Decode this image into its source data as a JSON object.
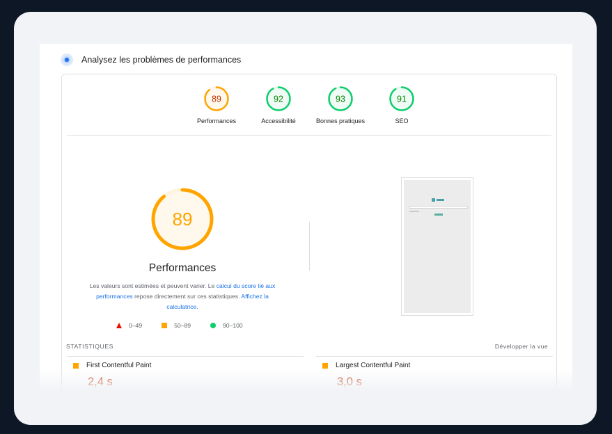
{
  "header": {
    "title": "Analysez les problèmes de performances",
    "icon": "lighthouse-icon"
  },
  "colors": {
    "average": "#ffa400",
    "good": "#0cce6b",
    "poor": "#eb0f00",
    "link": "#1a73e8",
    "value_average": "#c33300"
  },
  "gauges": [
    {
      "label": "Performances",
      "score": "89",
      "value": 89,
      "status": "average"
    },
    {
      "label": "Accessibilité",
      "score": "92",
      "value": 92,
      "status": "good"
    },
    {
      "label": "Bonnes pratiques",
      "score": "93",
      "value": 93,
      "status": "good"
    },
    {
      "label": "SEO",
      "score": "91",
      "value": 91,
      "status": "good"
    }
  ],
  "performance": {
    "score": "89",
    "value": 89,
    "title": "Performances",
    "desc_part1": "Les valeurs sont estimées et peuvent varier. Le ",
    "desc_link1": "calcul du score lié aux performances",
    "desc_part2": " repose directement sur ces statistiques. ",
    "desc_link2": "Affichez la calculatrice",
    "desc_part3": "."
  },
  "legend": [
    {
      "shape": "triangle",
      "range": "0–49"
    },
    {
      "shape": "square",
      "range": "50–89"
    },
    {
      "shape": "circle",
      "range": "90–100"
    }
  ],
  "statistics": {
    "title": "STATISTIQUES",
    "expand_label": "Développer la vue",
    "metrics": [
      {
        "name": "First Contentful Paint",
        "value": "2,4 s",
        "status": "average"
      },
      {
        "name": "Largest Contentful Paint",
        "value": "3,0 s",
        "status": "average"
      }
    ]
  }
}
